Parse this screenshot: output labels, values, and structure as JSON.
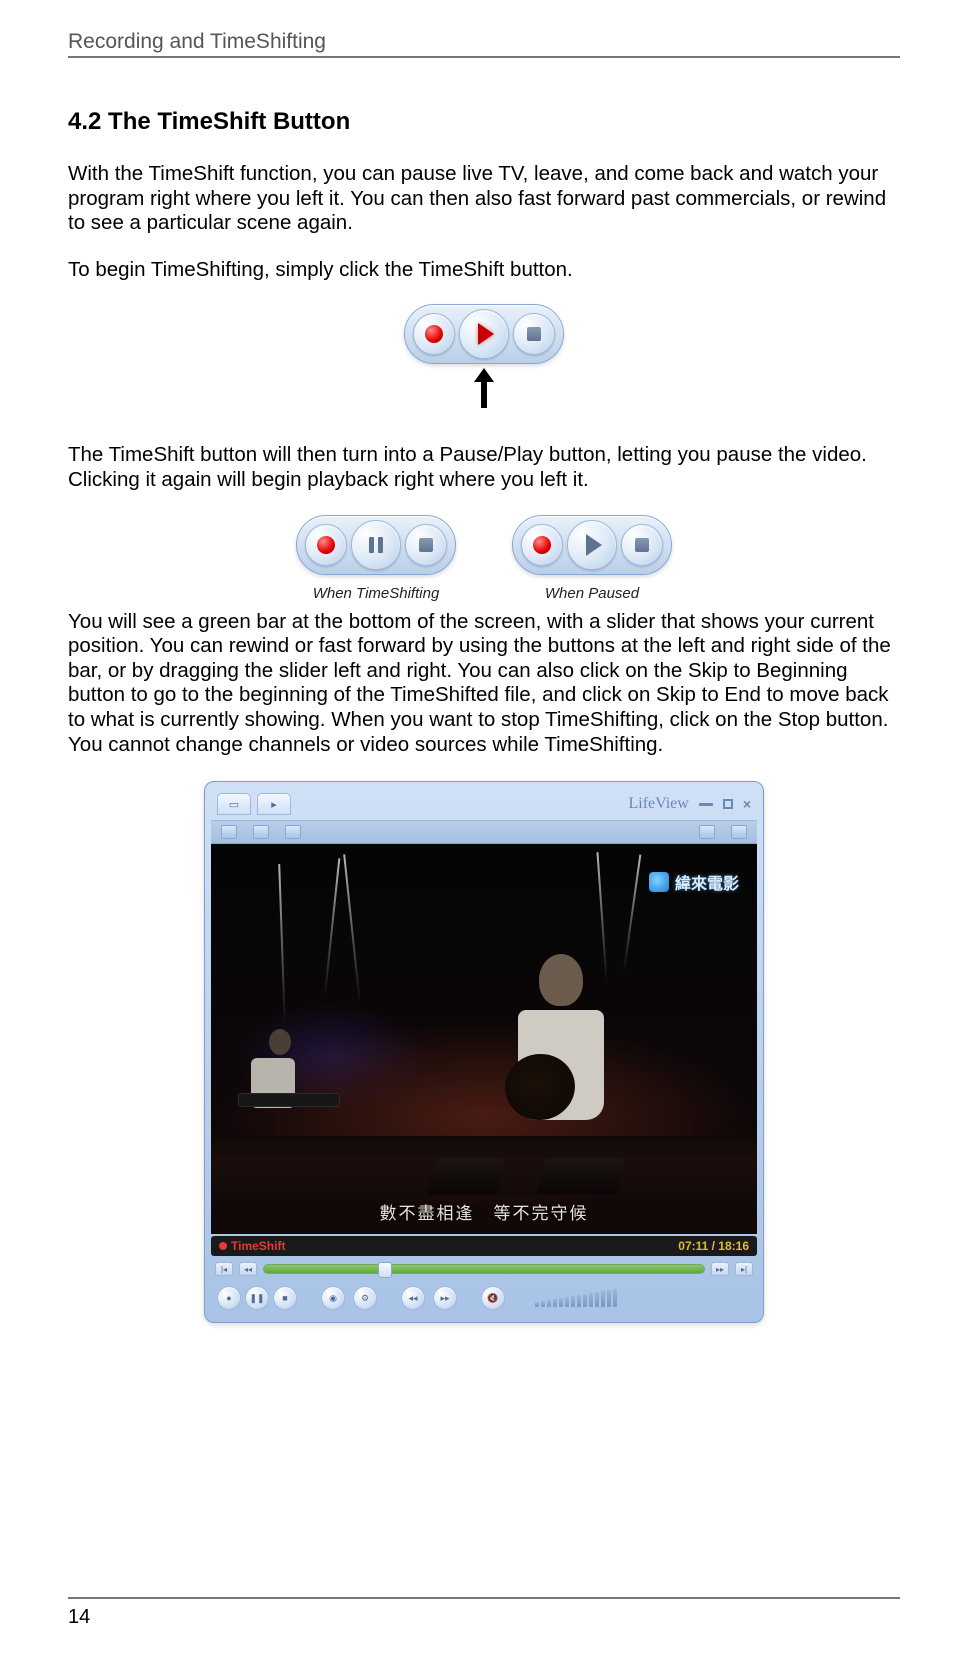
{
  "header": {
    "title": "Recording and TimeShifting"
  },
  "section": {
    "title": "4.2 The TimeShift Button"
  },
  "paragraphs": {
    "p1": "With the TimeShift function, you can pause live TV, leave, and come back and watch your program right where you left it. You can then also fast forward past commercials, or rewind to see a particular scene again.",
    "p2": "To begin TimeShifting, simply click the TimeShift button.",
    "p3": "The TimeShift button will then turn into a Pause/Play button, letting you pause the video. Clicking it again will begin playback right where you left it.",
    "p4": "You will see a green bar at the bottom of the screen, with a slider that shows your current position. You can rewind or fast forward by using the buttons at the left and right side of the bar, or by dragging the slider left and right. You can also click on the Skip to Beginning button to go to the beginning of the TimeShifted file, and click on Skip to End to move back to what is currently showing. When you want to stop TimeShifting, click on the Stop button. You cannot change channels or video sources while TimeShifting."
  },
  "captions": {
    "when_timeshifting": "When TimeShifting",
    "when_paused": "When Paused"
  },
  "player": {
    "brand": "LifeView",
    "watermark": "緯來電影",
    "subtitle": "數不盡相逢　等不完守候",
    "status_label": "TimeShift",
    "timecode": "07:11 / 18:16"
  },
  "page_number": "14"
}
